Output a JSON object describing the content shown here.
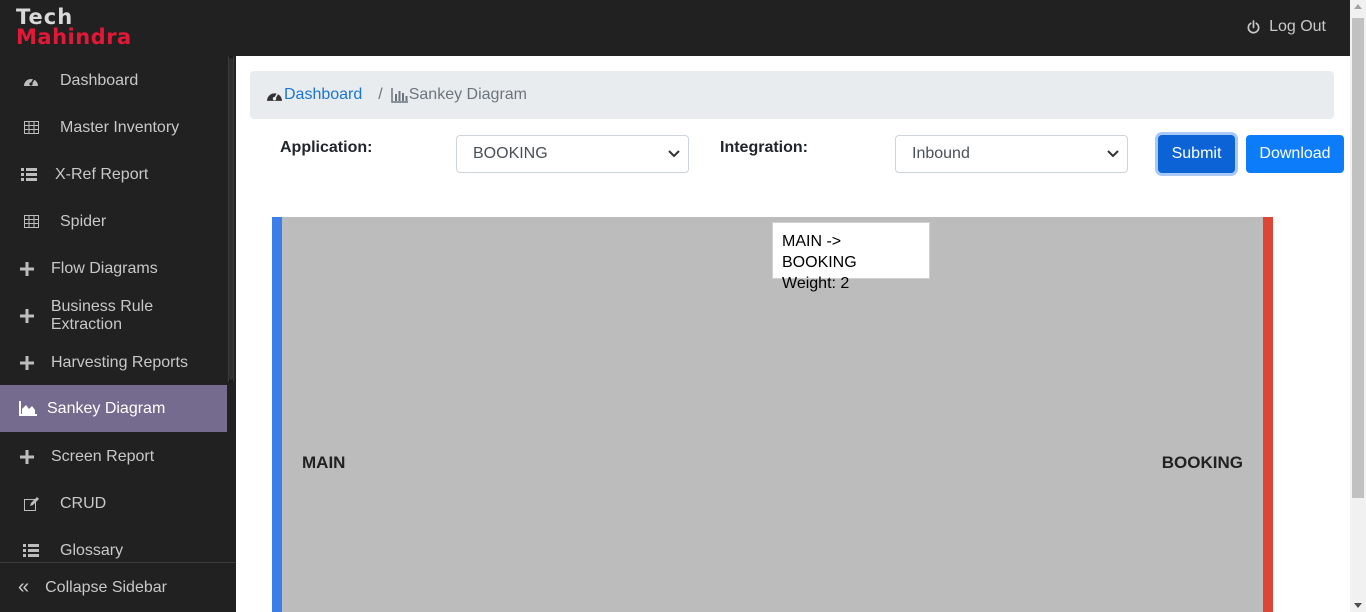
{
  "brand": {
    "line1": "Tech",
    "line2": "Mahindra"
  },
  "header": {
    "logout_label": "Log Out"
  },
  "sidebar": {
    "items": [
      {
        "label": "Dashboard",
        "icon": "dashboard-gauge-icon"
      },
      {
        "label": "Master Inventory",
        "icon": "table-icon"
      },
      {
        "label": "X-Ref Report",
        "icon": "list-icon"
      },
      {
        "label": "Spider",
        "icon": "table-icon"
      },
      {
        "label": "Flow Diagrams",
        "icon": "plus-icon"
      },
      {
        "label": "Business Rule Extraction",
        "icon": "plus-icon"
      },
      {
        "label": "Harvesting Reports",
        "icon": "plus-icon"
      },
      {
        "label": "Sankey Diagram",
        "icon": "area-chart-icon",
        "active": true
      },
      {
        "label": "Screen Report",
        "icon": "plus-icon"
      },
      {
        "label": "CRUD",
        "icon": "edit-icon"
      },
      {
        "label": "Glossary",
        "icon": "list-icon"
      }
    ],
    "collapse_label": "Collapse Sidebar"
  },
  "breadcrumb": {
    "home": "Dashboard",
    "separator": "/",
    "current": "Sankey Diagram"
  },
  "form": {
    "application_label": "Application:",
    "application_value": "BOOKING",
    "integration_label": "Integration:",
    "integration_value": "Inbound",
    "submit_label": "Submit",
    "download_label": "Download"
  },
  "sankey": {
    "source_node": "MAIN",
    "target_node": "BOOKING",
    "tooltip_line1": "MAIN -> BOOKING",
    "tooltip_line2": "Weight: 2",
    "link_weight": 2,
    "colors": {
      "source": "#3b7de9",
      "target": "#dd4535",
      "link": "#bcbcbc"
    }
  },
  "colors": {
    "topbar": "#212121",
    "active_item": "#756b8e",
    "primary": "#0d7cfb",
    "brand_red": "#e31837"
  }
}
